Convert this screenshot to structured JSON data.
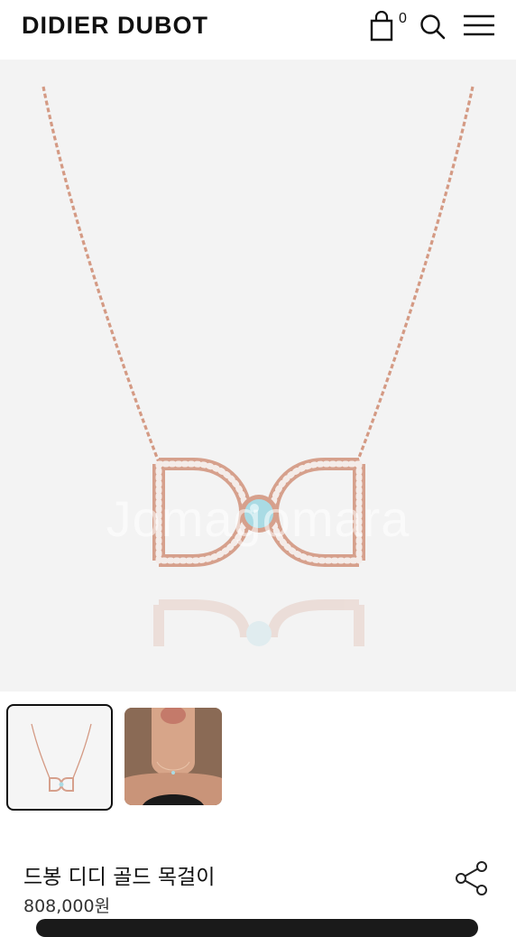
{
  "header": {
    "brand": "DIDIER DUBOT",
    "cart_count": "0",
    "icons": [
      "shopping-bag-icon",
      "search-icon",
      "hamburger-menu-icon"
    ]
  },
  "hero": {
    "watermark": "Jomagomara"
  },
  "thumbnails": [
    {
      "name": "product-thumbnail",
      "selected": true
    },
    {
      "name": "model-thumbnail",
      "selected": false
    }
  ],
  "product": {
    "name": "드봉 디디 골드 목걸이",
    "price": "808,000원"
  },
  "colors": {
    "rose_gold": "#d89a86",
    "stone": "#a9dbe4",
    "background": "#f3f3f3"
  }
}
